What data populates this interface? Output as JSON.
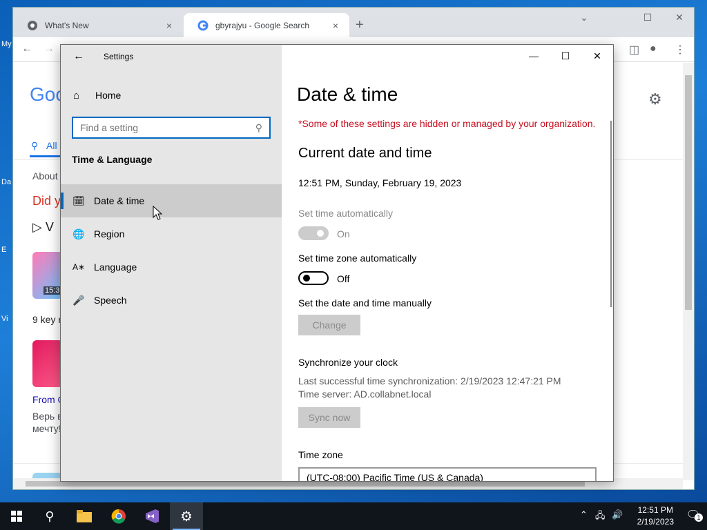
{
  "desktop": {
    "labels": [
      "My",
      "Da",
      "E",
      "Vi"
    ]
  },
  "browser": {
    "tabs": [
      {
        "title": "What's New",
        "close": "×"
      },
      {
        "title": "gbyrajyu - Google Search",
        "close": "×"
      }
    ],
    "new_tab": "+",
    "minimize": "⌄",
    "restore": "☐",
    "close": "✕",
    "page": {
      "logo": "Goo",
      "tab_all": "All",
      "about": "About",
      "did_you": "Did y",
      "video_letter": "V",
      "thumb1_time": "15:3",
      "key_text": "9 key r",
      "from_text": "From C",
      "ru_line1": "Верь в",
      "ru_line2": "мечту!"
    }
  },
  "settings": {
    "window_title": "Settings",
    "nav": {
      "home": "Home",
      "search_placeholder": "Find a setting",
      "section": "Time & Language",
      "items": [
        {
          "label": "Date & time",
          "icon": "calendar-clock-icon",
          "selected": true
        },
        {
          "label": "Region",
          "icon": "globe-icon",
          "selected": false
        },
        {
          "label": "Language",
          "icon": "language-icon",
          "selected": false
        },
        {
          "label": "Speech",
          "icon": "microphone-icon",
          "selected": false
        }
      ]
    },
    "content": {
      "title": "Date & time",
      "warning": "*Some of these settings are hidden or managed by your organization.",
      "current_heading": "Current date and time",
      "current_value": "12:51 PM, Sunday, February 19, 2023",
      "set_time_auto_label": "Set time automatically",
      "set_time_auto_state": "On",
      "set_tz_auto_label": "Set time zone automatically",
      "set_tz_auto_state": "Off",
      "manual_label": "Set the date and time manually",
      "change_button": "Change",
      "sync_heading": "Synchronize your clock",
      "sync_last": "Last successful time synchronization: 2/19/2023 12:47:21 PM",
      "sync_server": "Time server: AD.collabnet.local",
      "sync_button": "Sync now",
      "timezone_label": "Time zone",
      "timezone_value": "(UTC-08:00) Pacific Time (US & Canada)"
    }
  },
  "taskbar": {
    "clock_time": "12:51 PM",
    "clock_date": "2/19/2023",
    "notification_count": "1"
  }
}
